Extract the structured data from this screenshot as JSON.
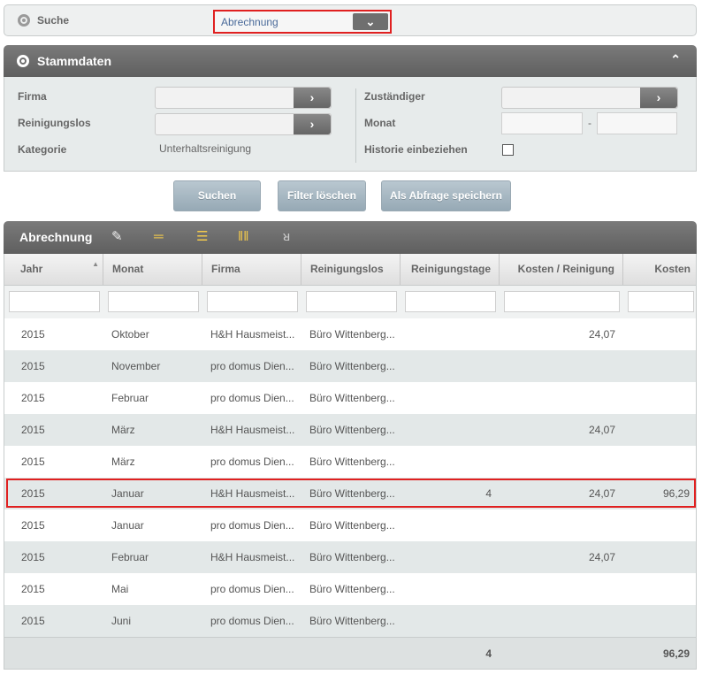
{
  "search": {
    "label": "Suche",
    "selected": "Abrechnung",
    "dropdown_icon": "chevron-down-icon"
  },
  "stamm": {
    "title": "Stammdaten",
    "collapse_icon": "chevron-up-icon",
    "firma_label": "Firma",
    "reinigungslos_label": "Reinigungslos",
    "kategorie_label": "Kategorie",
    "kategorie_value": "Unterhaltsreinigung",
    "zustaendiger_label": "Zuständiger",
    "monat_label": "Monat",
    "monat_sep": "-",
    "historie_label": "Historie einbeziehen",
    "historie_checked": false
  },
  "buttons": {
    "suchen": "Suchen",
    "filter_loeschen": "Filter löschen",
    "als_abfrage": "Als Abfrage speichern"
  },
  "grid": {
    "title": "Abrechnung",
    "tools": [
      "edit-icon",
      "single-line-icon",
      "multi-line-icon",
      "columns-icon",
      "filter-icon"
    ],
    "columns": [
      "Jahr",
      "Monat",
      "Firma",
      "Reinigungslos",
      "Reinigungstage",
      "Kosten / Reinigung",
      "Kosten"
    ],
    "sort_indicator": "▲",
    "rows": [
      [
        "2015",
        "Oktober",
        "H&H Hausmeist...",
        "Büro Wittenberg...",
        "",
        "24,07",
        ""
      ],
      [
        "2015",
        "November",
        "pro domus Dien...",
        "Büro Wittenberg...",
        "",
        "",
        ""
      ],
      [
        "2015",
        "Februar",
        "pro domus Dien...",
        "Büro Wittenberg...",
        "",
        "",
        ""
      ],
      [
        "2015",
        "März",
        "H&H Hausmeist...",
        "Büro Wittenberg...",
        "",
        "24,07",
        ""
      ],
      [
        "2015",
        "März",
        "pro domus Dien...",
        "Büro Wittenberg...",
        "",
        "",
        ""
      ],
      [
        "2015",
        "Januar",
        "H&H Hausmeist...",
        "Büro Wittenberg...",
        "4",
        "24,07",
        "96,29"
      ],
      [
        "2015",
        "Januar",
        "pro domus Dien...",
        "Büro Wittenberg...",
        "",
        "",
        ""
      ],
      [
        "2015",
        "Februar",
        "H&H Hausmeist...",
        "Büro Wittenberg...",
        "",
        "24,07",
        ""
      ],
      [
        "2015",
        "Mai",
        "pro domus Dien...",
        "Büro Wittenberg...",
        "",
        "",
        ""
      ],
      [
        "2015",
        "Juni",
        "pro domus Dien...",
        "Büro Wittenberg...",
        "",
        "",
        ""
      ]
    ],
    "selected_row": 5,
    "footer": {
      "reinigungstage": "4",
      "kosten": "96,29"
    },
    "colors": {
      "row_even": "#ffffff",
      "row_odd": "#e3e8e8",
      "highlight": "#e02020"
    }
  }
}
